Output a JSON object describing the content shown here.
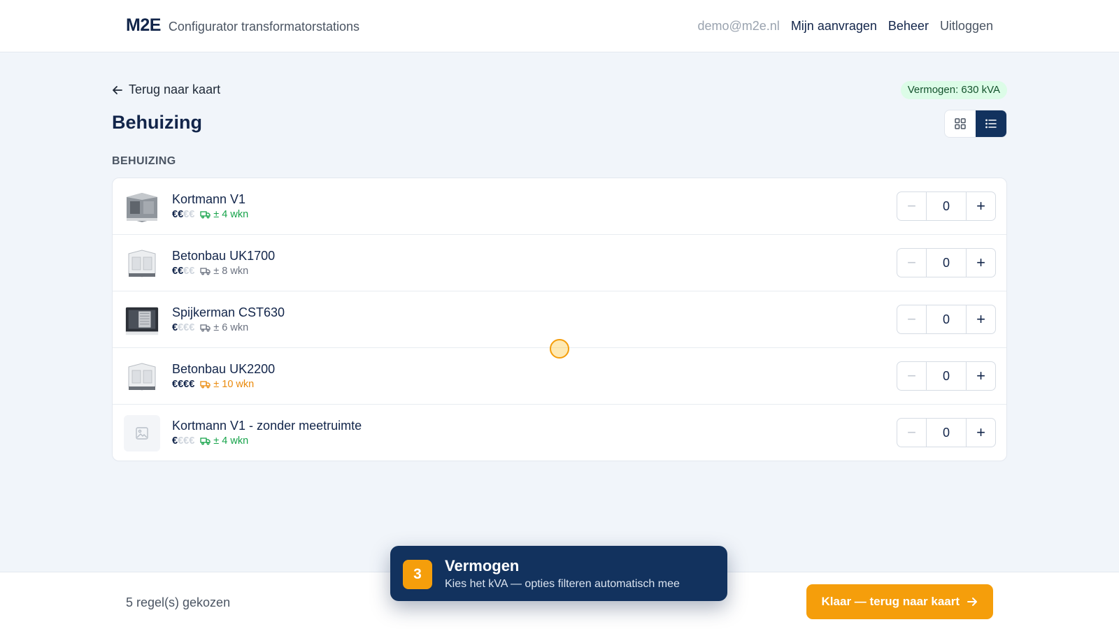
{
  "header": {
    "logo": "M2E",
    "subtitle": "Configurator transformatorstations",
    "user_email": "demo@m2e.nl",
    "nav": {
      "requests": "Mijn aanvragen",
      "admin": "Beheer",
      "logout": "Uitloggen"
    }
  },
  "page": {
    "back_label": "Terug naar kaart",
    "power_badge": "Vermogen: 630 kVA",
    "title": "Behuizing",
    "section_label": "BEHUIZING",
    "view_mode": "list"
  },
  "items": [
    {
      "name": "Kortmann V1",
      "price_on": "€€",
      "price_off": "€€",
      "delivery": "± 4 wkn",
      "delivery_tone": "green",
      "qty": "0",
      "image_icon": "kiosk-gray-icon"
    },
    {
      "name": "Betonbau UK1700",
      "price_on": "€€",
      "price_off": "€€",
      "delivery": "± 8 wkn",
      "delivery_tone": "gray",
      "qty": "0",
      "image_icon": "kiosk-white-icon"
    },
    {
      "name": "Spijkerman CST630",
      "price_on": "€",
      "price_off": "€€€",
      "delivery": "± 6 wkn",
      "delivery_tone": "gray",
      "qty": "0",
      "image_icon": "kiosk-dark-icon"
    },
    {
      "name": "Betonbau UK2200",
      "price_on": "€€€€",
      "price_off": "",
      "delivery": "± 10 wkn",
      "delivery_tone": "orange",
      "qty": "0",
      "image_icon": "kiosk-white-icon"
    },
    {
      "name": "Kortmann V1 - zonder meetruimte",
      "price_on": "€",
      "price_off": "€€€",
      "delivery": "± 4 wkn",
      "delivery_tone": "green",
      "qty": "0",
      "image_icon": "image-placeholder-icon"
    }
  ],
  "footer": {
    "selection_count": "5 regel(s) gekozen",
    "done_label": "Klaar — terug naar kaart"
  },
  "tour": {
    "step": "3",
    "title": "Vermogen",
    "text": "Kies het kVA — opties filteren automatisch mee"
  },
  "colors": {
    "navy": "#12325e",
    "accent": "#f59e0b",
    "green": "#16a34a",
    "orange": "#ea8a0c",
    "badge_bg": "#dcfce7"
  }
}
